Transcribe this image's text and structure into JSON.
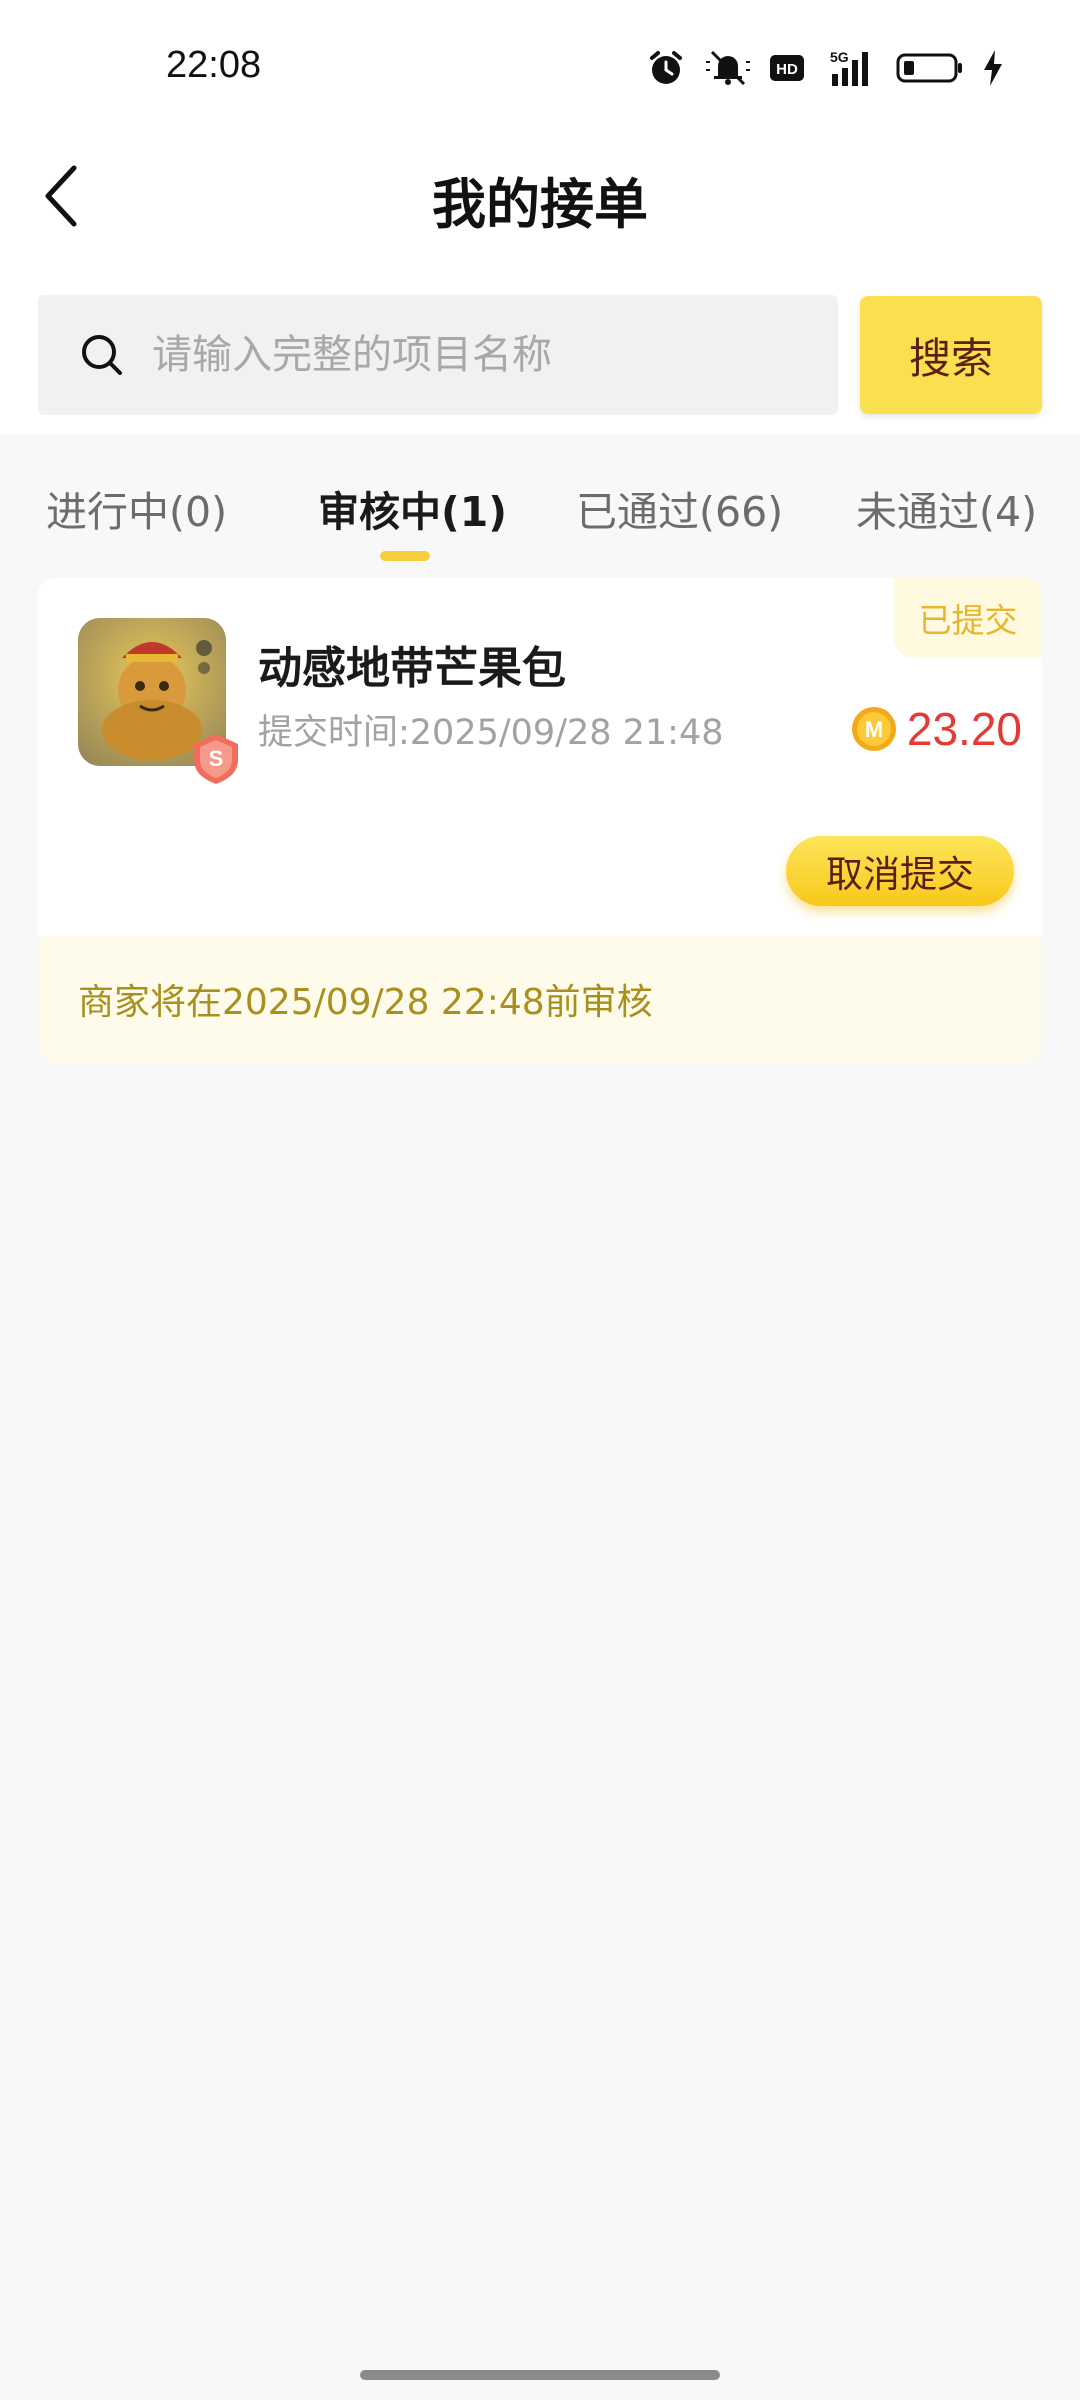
{
  "status_bar": {
    "time": "22:08",
    "icons": [
      "alarm-icon",
      "mute-bell-icon",
      "hd-icon",
      "5g-signal-icon",
      "battery-icon",
      "charging-icon"
    ],
    "hd_label": "HD",
    "network_label": "5G"
  },
  "header": {
    "title": "我的接单",
    "back_icon": "chevron-left-icon"
  },
  "search": {
    "placeholder": "请输入完整的项目名称",
    "value": "",
    "button_label": "搜索"
  },
  "tabs": [
    {
      "label": "进行中(0)",
      "active": false
    },
    {
      "label": "审核中(1)",
      "active": true
    },
    {
      "label": "已通过(66)",
      "active": false
    },
    {
      "label": "未通过(4)",
      "active": false
    }
  ],
  "orders": [
    {
      "name": "动感地带芒果包",
      "submit_time": "提交时间:2025/09/28 21:48",
      "status": "已提交",
      "reward": "23.20",
      "coin_letter": "M",
      "badge_letter": "S",
      "action_label": "取消提交",
      "review_note": "商家将在2025/09/28 22:48前审核"
    }
  ],
  "colors": {
    "accent_yellow": "#fadf4e",
    "reward_red": "#e53a33",
    "status_text": "#e8b52e",
    "note_text": "#a8901e"
  }
}
